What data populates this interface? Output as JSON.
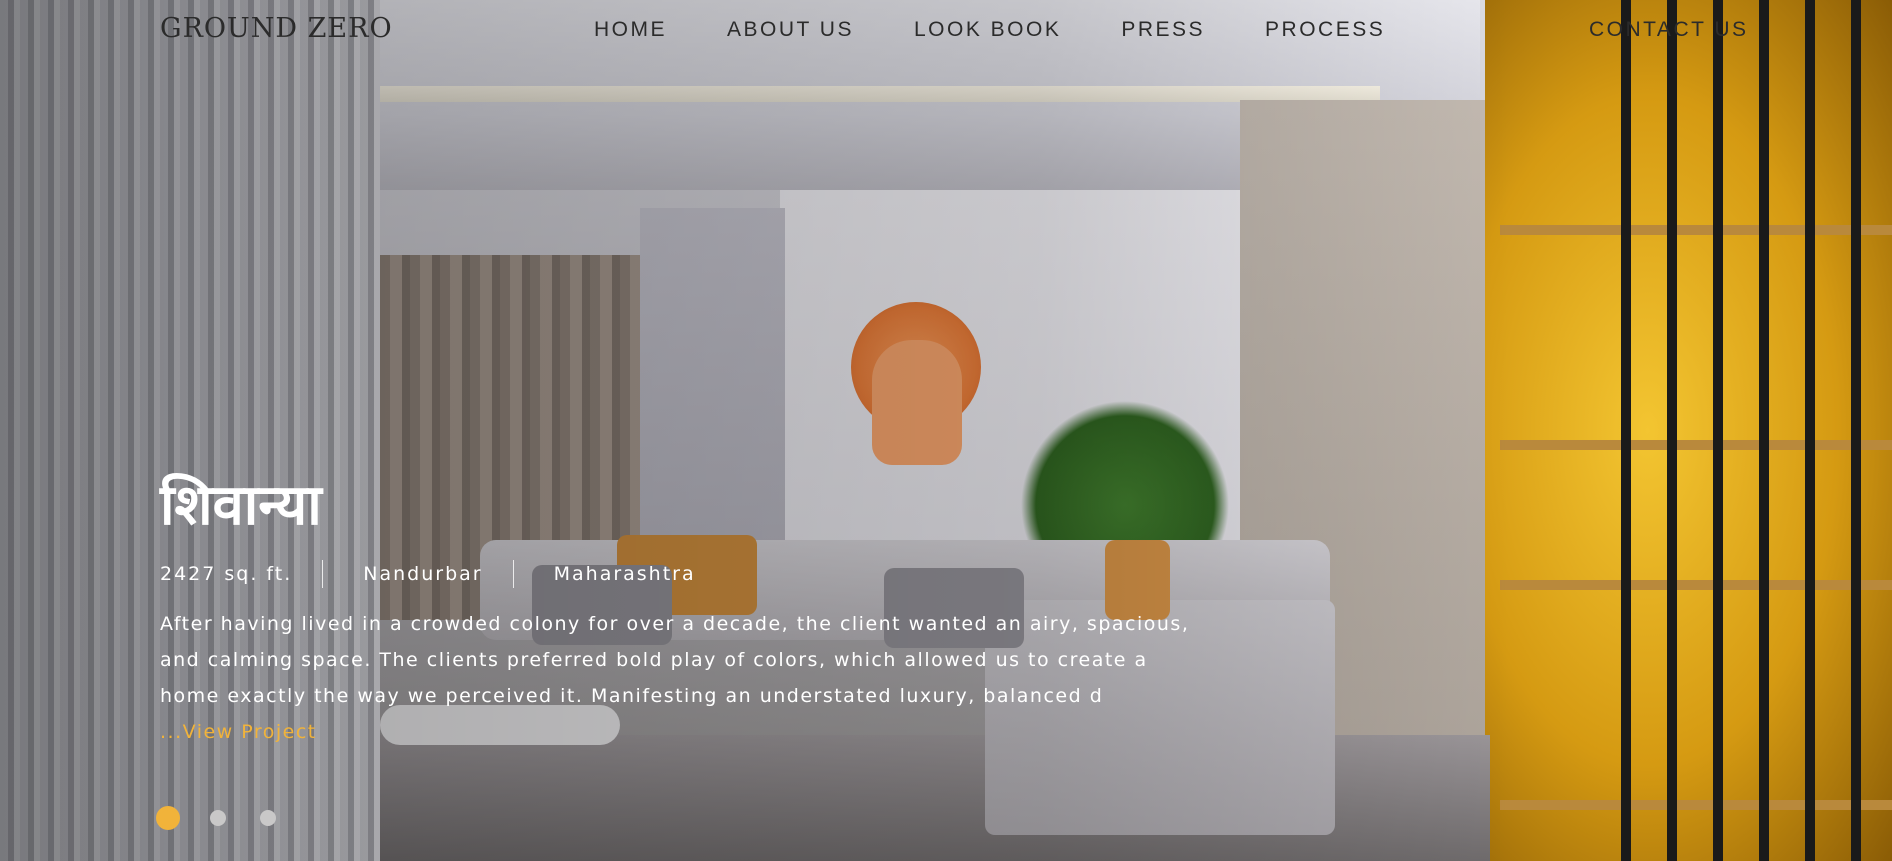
{
  "header": {
    "logo": "GROUND ZERO",
    "nav": [
      "HOME",
      "ABOUT US",
      "LOOK BOOK",
      "PRESS",
      "PROCESS"
    ],
    "contact": "CONTACT US"
  },
  "hero": {
    "title": "शिवान्या",
    "meta": {
      "area": "2427 sq. ft.",
      "city": "Nandurbar",
      "state": "Maharashtra"
    },
    "description": "After having lived in a crowded colony for over a decade, the client wanted an airy, spacious, and calming space. The clients preferred bold play of colors, which allowed us to create a home exactly the way we perceived it. Manifesting an understated luxury, balanced d",
    "link": "...View Project"
  },
  "slider": {
    "count": 3,
    "active_index": 0
  },
  "colors": {
    "accent": "#f1b33a",
    "nav_text": "#2b2b2b",
    "hero_text": "#ffffff"
  }
}
